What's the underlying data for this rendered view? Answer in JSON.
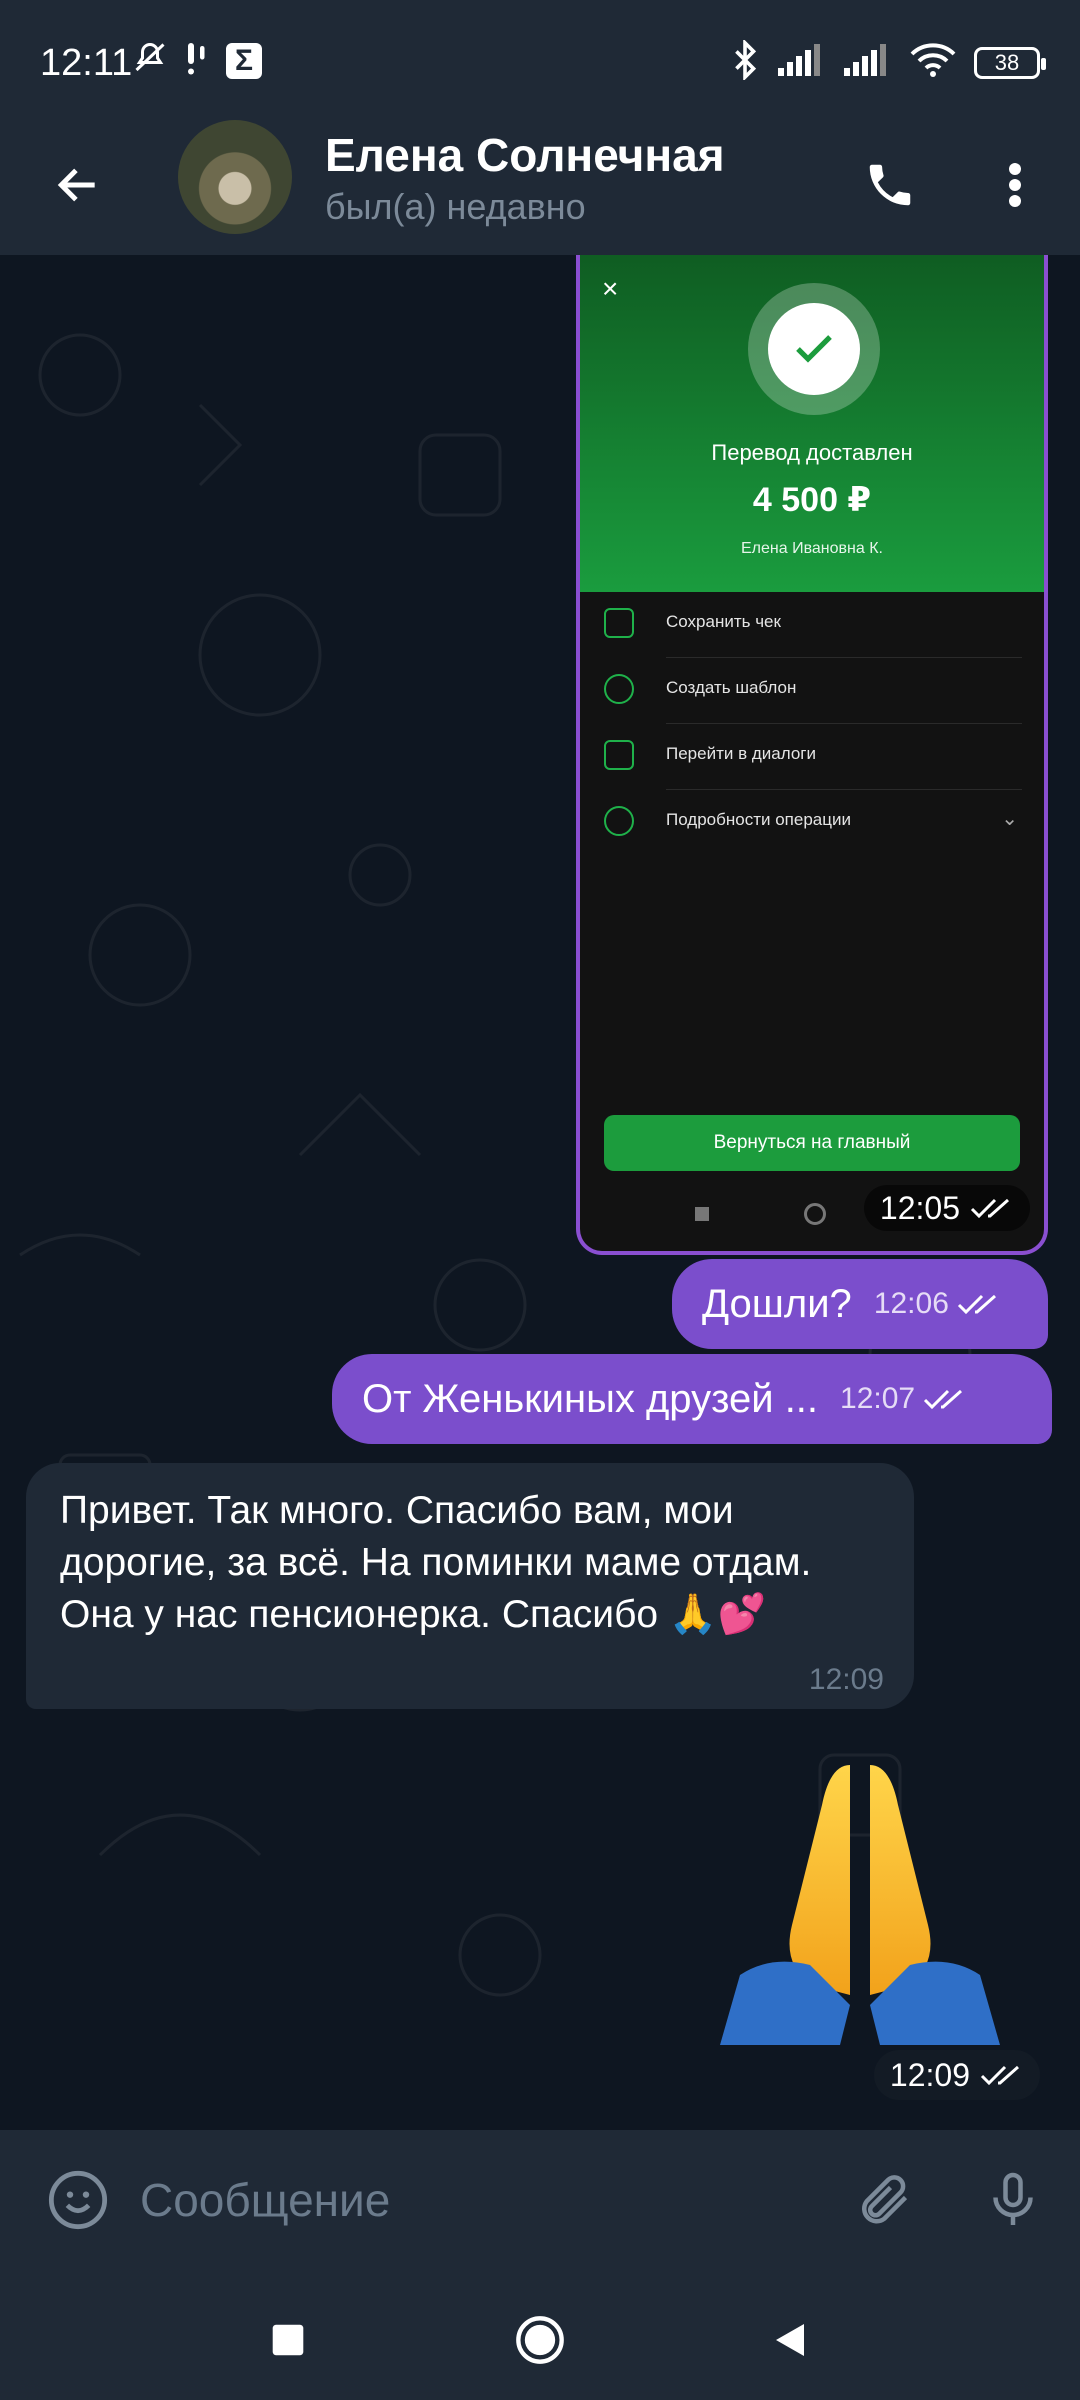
{
  "status_bar": {
    "time": "12:11",
    "battery": "38",
    "sigma": "Σ",
    "icons": [
      "mute-icon",
      "alert-icon",
      "sigma-icon",
      "bluetooth-icon",
      "signal-icon",
      "signal-icon",
      "wifi-icon",
      "battery-icon"
    ]
  },
  "header": {
    "name": "Елена Солнечная",
    "status": "был(а) недавно"
  },
  "receipt_image": {
    "close": "×",
    "title": "Перевод доставлен",
    "amount": "4 500 ₽",
    "recipient": "Елена Ивановна К.",
    "options": [
      {
        "label": "Сохранить чек"
      },
      {
        "label": "Создать шаблон"
      },
      {
        "label": "Перейти в диалоги"
      },
      {
        "label": "Подробности операции"
      }
    ],
    "home_button": "Вернуться на главный",
    "time": "12:05"
  },
  "messages": [
    {
      "direction": "out",
      "text": "Дошли?",
      "time": "12:06"
    },
    {
      "direction": "out",
      "text": "От Женькиных друзей ...",
      "time": "12:07"
    },
    {
      "direction": "in",
      "text": "Привет. Так много. Спасибо вам, мои дорогие, за всё. На поминки маме отдам. Она у нас пенсионерка. Спасибо 🙏💕",
      "time": "12:09"
    }
  ],
  "sticker": {
    "emoji": "🙏",
    "time": "12:09"
  },
  "composer": {
    "placeholder": "Сообщение"
  },
  "colors": {
    "bg": "#0e1621",
    "bar": "#1f2936",
    "outgoing_bubble": "#7b4ecc",
    "incoming_bubble": "#1f2936",
    "green": "#1c9c3d"
  }
}
